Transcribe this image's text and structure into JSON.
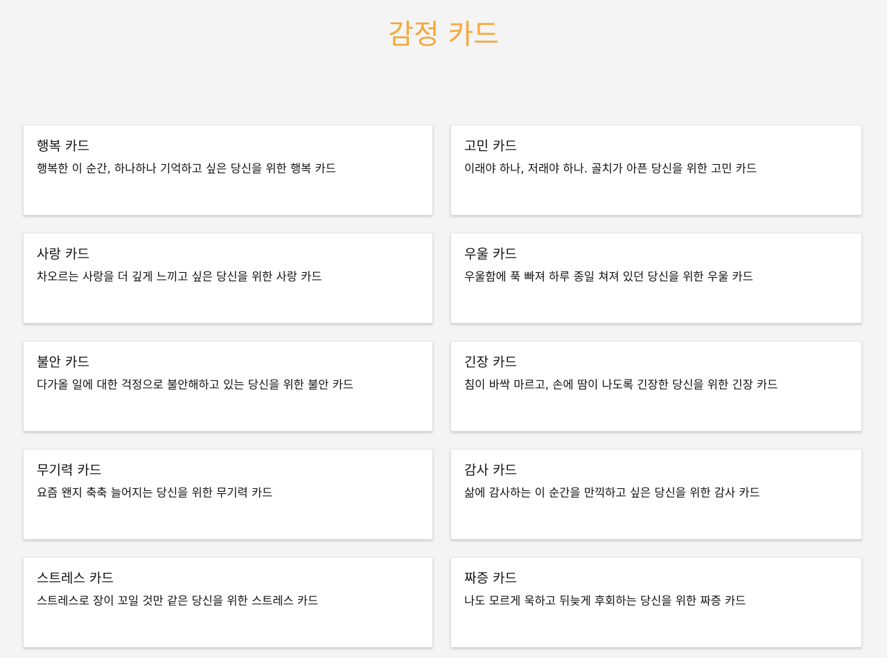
{
  "page": {
    "title": "감정 카드",
    "title_color": "#f5a83a",
    "background": "#f4f4f4"
  },
  "cards": [
    {
      "title": "행복 카드",
      "description": "행복한 이 순간, 하나하나 기억하고 싶은 당신을 위한 행복 카드"
    },
    {
      "title": "고민 카드",
      "description": "이래야 하나, 저래야 하나. 골치가 아픈 당신을 위한 고민 카드"
    },
    {
      "title": "사랑 카드",
      "description": "차오르는 사랑을 더 깊게 느끼고 싶은 당신을 위한 사랑 카드"
    },
    {
      "title": "우울 카드",
      "description": "우울함에 푹 빠져 하루 종일 쳐져 있던 당신을 위한 우울 카드"
    },
    {
      "title": "불안 카드",
      "description": "다가올 일에 대한 걱정으로 불안해하고 있는 당신을 위한 불안 카드"
    },
    {
      "title": "긴장 카드",
      "description": "침이 바싹 마르고, 손에 땀이 나도록 긴장한 당신을 위한 긴장 카드"
    },
    {
      "title": "무기력 카드",
      "description": "요즘 왠지 축축 늘어지는 당신을 위한 무기력 카드"
    },
    {
      "title": "감사 카드",
      "description": "삶에 감사하는 이 순간을 만끽하고 싶은 당신을 위한 감사 카드"
    },
    {
      "title": "스트레스 카드",
      "description": "스트레스로 장이 꼬일 것만 같은 당신을 위한 스트레스 카드"
    },
    {
      "title": "짜증 카드",
      "description": "나도 모르게 욱하고 뒤늦게 후회하는 당신을 위한 짜증 카드"
    }
  ]
}
